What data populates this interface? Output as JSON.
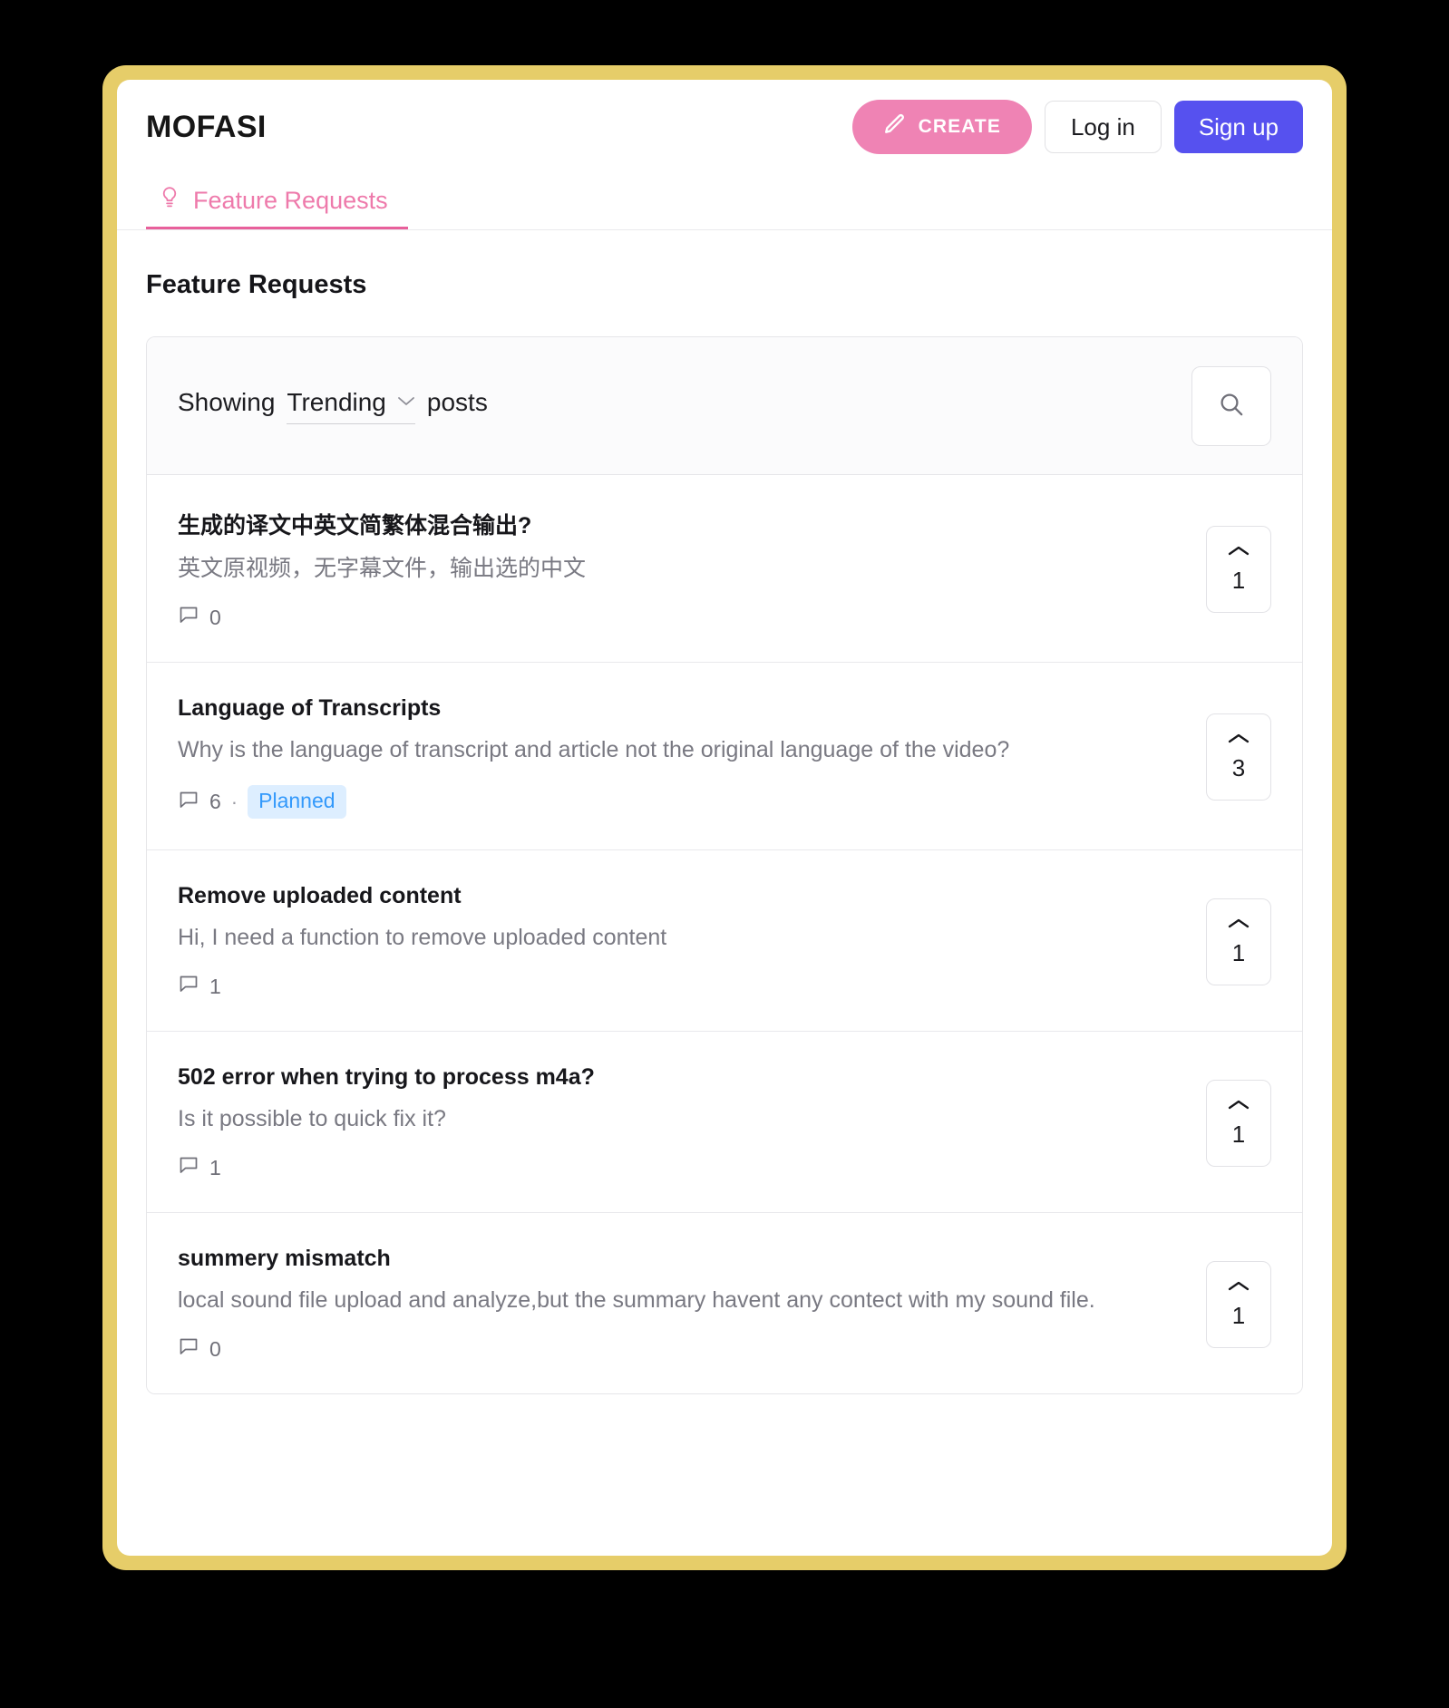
{
  "header": {
    "brand": "MOFASI",
    "create_label": "CREATE",
    "create_icon": "pencil-icon",
    "login_label": "Log in",
    "signup_label": "Sign up",
    "accent_pink": "#ef83b4",
    "accent_indigo": "#5651ef"
  },
  "tabs": [
    {
      "label": "Feature Requests",
      "icon": "lightbulb-icon",
      "active": true
    }
  ],
  "page": {
    "title": "Feature Requests"
  },
  "filter": {
    "prefix": "Showing",
    "sort_value": "Trending",
    "suffix": "posts",
    "caret_icon": "chevron-down-icon",
    "search_icon": "search-icon"
  },
  "posts": [
    {
      "title": "生成的译文中英文简繁体混合输出?",
      "description": "英文原视频，无字幕文件，输出选的中文",
      "comments": "0",
      "status": null,
      "votes": "1"
    },
    {
      "title": "Language of Transcripts",
      "description": "Why is the language of transcript and article not the original language of the video?",
      "comments": "6",
      "status": "Planned",
      "status_color": "#3399fb",
      "status_bg": "#ddeeff",
      "votes": "3"
    },
    {
      "title": "Remove uploaded content",
      "description": "Hi, I need a function to remove uploaded content",
      "comments": "1",
      "status": null,
      "votes": "1"
    },
    {
      "title": "502 error when trying to process m4a?",
      "description": "Is it possible to quick fix it?",
      "comments": "1",
      "status": null,
      "votes": "1"
    },
    {
      "title": "summery mismatch",
      "description": "local sound file upload and analyze,but the summary havent any contect with my sound file.",
      "comments": "0",
      "status": null,
      "votes": "1"
    }
  ],
  "meta": {
    "separator_dot": "·"
  }
}
